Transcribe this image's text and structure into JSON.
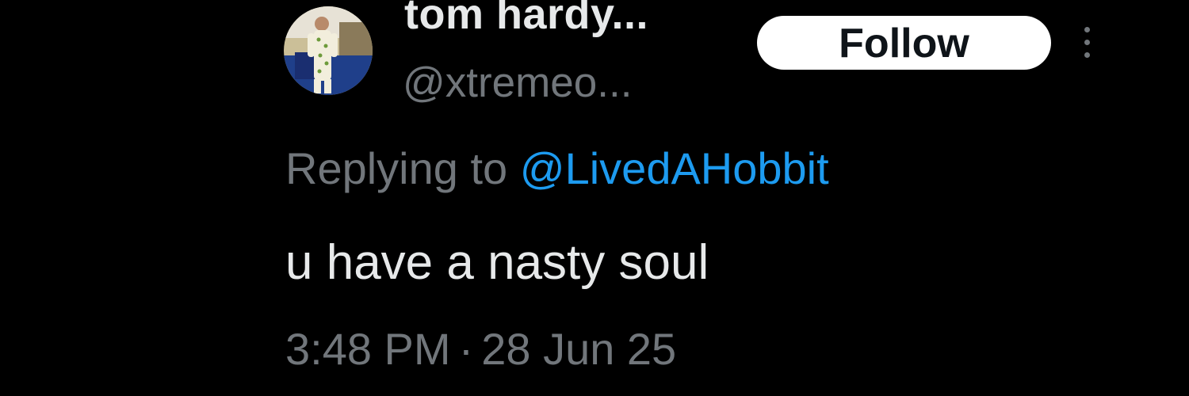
{
  "author": {
    "display_name": "tom hardy...",
    "handle": "@xtremeo...",
    "avatar": "profile-photo"
  },
  "follow_button": {
    "label": "Follow"
  },
  "menu": {
    "icon": "more-vertical-icon"
  },
  "reply": {
    "prefix": "Replying to",
    "mention": "@LivedAHobbit"
  },
  "tweet": {
    "text": "u have a nasty soul",
    "time": "3:48 PM",
    "separator": "·",
    "date": "28 Jun 25"
  },
  "colors": {
    "background": "#000000",
    "primary_text": "#e7e9ea",
    "secondary_text": "#71767b",
    "link": "#1d9bf0",
    "button_bg": "#ffffff"
  }
}
